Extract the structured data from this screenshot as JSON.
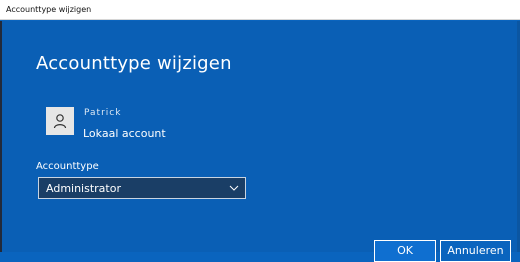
{
  "window": {
    "title": "Accounttype wijzigen"
  },
  "dialog": {
    "heading": "Accounttype wijzigen",
    "user": {
      "name": "Patrick",
      "account_kind": "Lokaal account",
      "avatar_icon": "person-icon"
    },
    "account_type": {
      "label": "Accounttype",
      "selected": "Administrator"
    },
    "buttons": {
      "ok": "OK",
      "cancel": "Annuleren"
    }
  },
  "colors": {
    "background": "#0a5fb5",
    "select_background": "#1a3e66",
    "text": "#ffffff"
  }
}
